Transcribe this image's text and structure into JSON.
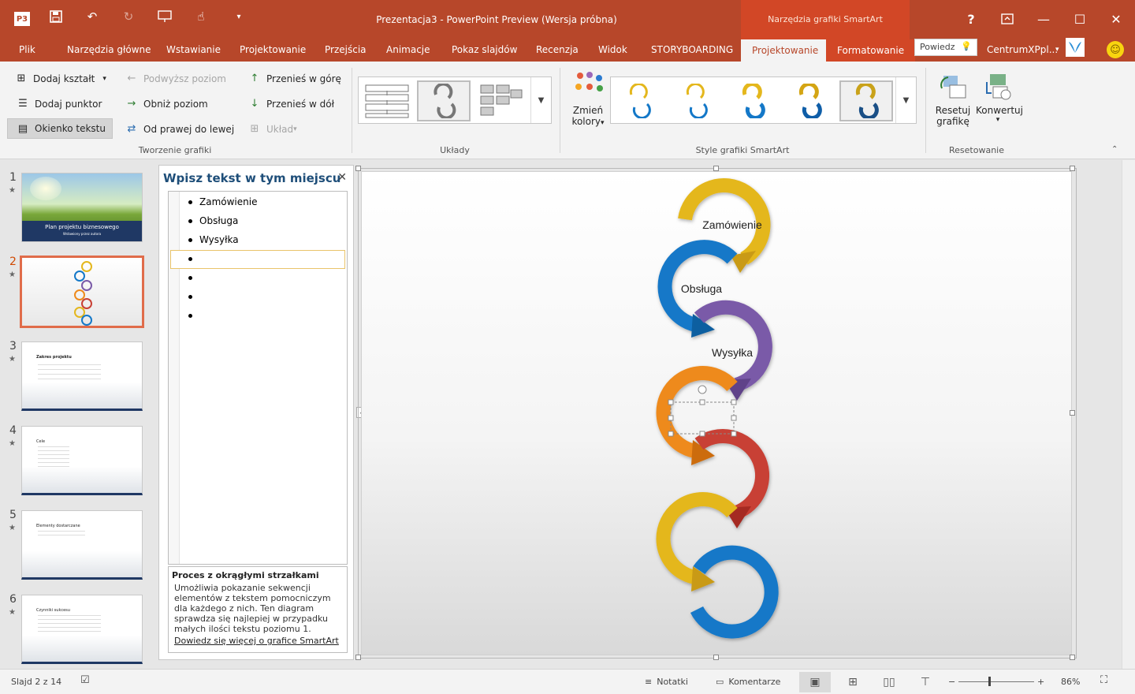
{
  "app": {
    "title": "Prezentacja3 - PowerPoint Preview (Wersja próbna)",
    "context_group": "Narzędzia grafiki SmartArt",
    "logo_text": "P3"
  },
  "tabs": {
    "items": [
      "Plik",
      "Narzędzia główne",
      "Wstawianie",
      "Projektowanie",
      "Przejścia",
      "Animacje",
      "Pokaz slajdów",
      "Recenzja",
      "Widok",
      "STORYBOARDING",
      "Projektowanie",
      "Formatowanie"
    ],
    "active_index": 10,
    "tellme": "Powiedz",
    "user": "CentrumXPpl..."
  },
  "ribbon": {
    "create": {
      "add_shape": "Dodaj kształt",
      "add_bullet": "Dodaj punktor",
      "text_pane": "Okienko tekstu",
      "promote": "Podwyższ poziom",
      "demote": "Obniż poziom",
      "rtl": "Od prawej do lewej",
      "move_up": "Przenieś w górę",
      "move_down": "Przenieś w dół",
      "layout": "Układ",
      "label": "Tworzenie grafiki"
    },
    "layouts_label": "Układy",
    "change_colors": [
      "Zmień",
      "kolory"
    ],
    "styles_label": "Style grafiki SmartArt",
    "reset_graphic": [
      "Resetuj",
      "grafikę"
    ],
    "convert": "Konwertuj",
    "reset_label": "Resetowanie"
  },
  "slides": [
    {
      "num": "1",
      "title": "Plan projektu biznesowego",
      "subtitle": "Wstawiony przez autora"
    },
    {
      "num": "2"
    },
    {
      "num": "3",
      "title": "Zakres projektu"
    },
    {
      "num": "4",
      "title": "Cele"
    },
    {
      "num": "5",
      "title": "Elementy dostarczane"
    },
    {
      "num": "6",
      "title": "Czynniki sukcesu"
    }
  ],
  "text_pane": {
    "title": "Wpisz tekst w tym miejscu",
    "bullets": [
      "Zamówienie",
      "Obsługa",
      "Wysyłka",
      "",
      "",
      "",
      ""
    ],
    "desc_title": "Proces z okrągłymi strzałkami",
    "desc_body": "Umożliwia pokazanie sekwencji elementów z tekstem pomocniczym dla każdego z nich. Ten diagram sprawdza się najlepiej w przypadku małych ilości tekstu poziomu 1.",
    "desc_link": "Dowiedz się więcej o grafice SmartArt"
  },
  "diagram": {
    "labels": [
      "Zamówienie",
      "Obsługa",
      "Wysyłka"
    ],
    "colors": [
      "#e4b71d",
      "#1478c8",
      "#7a5aa8",
      "#ee8a1c",
      "#c84034",
      "#e4b71d",
      "#1478c8"
    ]
  },
  "status": {
    "slide": "Slajd 2 z 14",
    "notes": "Notatki",
    "comments": "Komentarze",
    "zoom": "86%"
  }
}
